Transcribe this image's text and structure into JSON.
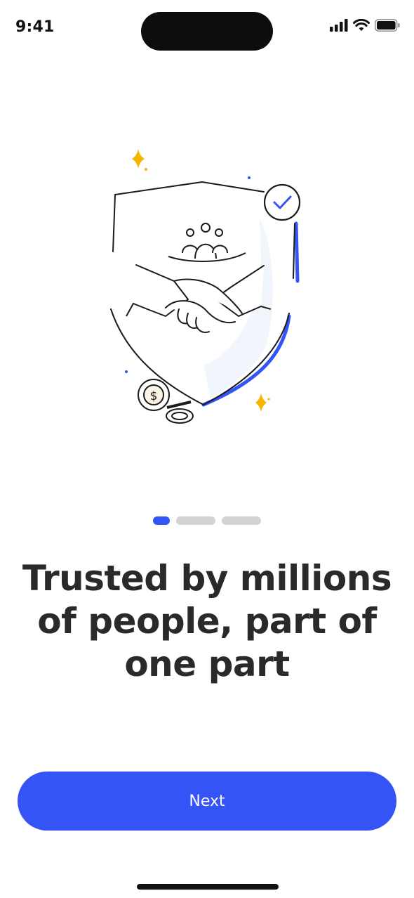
{
  "status_bar": {
    "time": "9:41",
    "icons": [
      "cellular-signal-icon",
      "wifi-icon",
      "battery-icon"
    ]
  },
  "onboarding": {
    "illustration": "shield-handshake-illustration",
    "page_indicator": {
      "total": 3,
      "active_index": 0
    },
    "headline_lines": [
      "Trusted by millions",
      "of people, part of",
      "one part"
    ],
    "next_label": "Next"
  },
  "colors": {
    "accent": "#3454f6",
    "indicator_inactive": "#d3d3d3",
    "text": "#2a2a2a",
    "sparkle": "#f5b400"
  }
}
